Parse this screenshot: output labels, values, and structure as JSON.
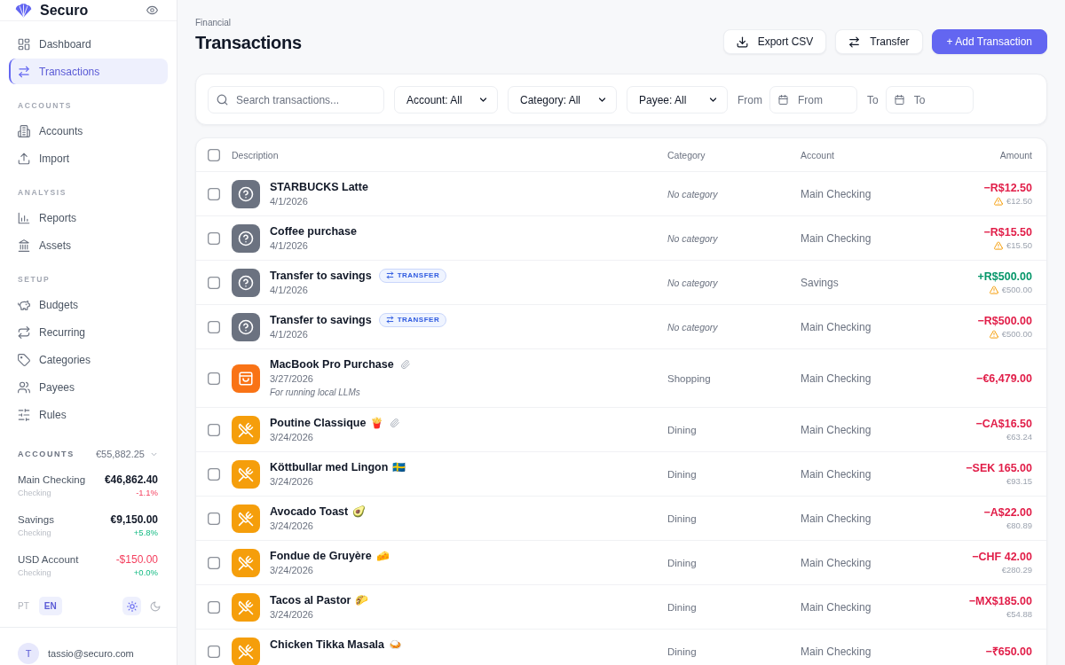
{
  "sidebar": {
    "brand": "Securo",
    "nav": [
      {
        "items": [
          {
            "label": "Dashboard",
            "selected": false
          },
          {
            "label": "Transactions",
            "selected": true
          }
        ]
      },
      {
        "heading": "ACCOUNTS",
        "items": [
          {
            "label": "Accounts",
            "selected": false
          },
          {
            "label": "Import",
            "selected": false
          }
        ]
      },
      {
        "heading": "ANALYSIS",
        "items": [
          {
            "label": "Reports",
            "selected": false
          },
          {
            "label": "Assets",
            "selected": false
          }
        ]
      },
      {
        "heading": "SETUP",
        "items": [
          {
            "label": "Budgets",
            "selected": false
          },
          {
            "label": "Recurring",
            "selected": false
          },
          {
            "label": "Categories",
            "selected": false
          },
          {
            "label": "Payees",
            "selected": false
          },
          {
            "label": "Rules",
            "selected": false
          }
        ]
      }
    ],
    "accounts_summary": {
      "heading": "ACCOUNTS",
      "total": "€55,882.25",
      "accounts": [
        {
          "name": "Main Checking",
          "type": "Checking",
          "balance": "€46,862.40",
          "balance_negative": false,
          "change": "-1.1%",
          "change_negative": true
        },
        {
          "name": "Savings",
          "type": "Checking",
          "balance": "€9,150.00",
          "balance_negative": false,
          "change": "+5.8%",
          "change_negative": false
        },
        {
          "name": "USD Account",
          "type": "Checking",
          "balance": "-$150.00",
          "balance_negative": true,
          "change": "+0.0%",
          "change_negative": false
        }
      ]
    },
    "languages": [
      {
        "label": "PT",
        "selected": false
      },
      {
        "label": "EN",
        "selected": true
      }
    ],
    "theme_toggle": [
      {
        "selected": true
      },
      {
        "selected": false
      }
    ],
    "user": {
      "initial": "T",
      "email": "tassio@securo.com"
    }
  },
  "header": {
    "breadcrumb": "Financial",
    "title": "Transactions",
    "actions": [
      {
        "label": "Export CSV",
        "kind": "secondary"
      },
      {
        "label": "Transfer",
        "kind": "secondary"
      },
      {
        "label": "+ Add Transaction",
        "kind": "primary"
      }
    ]
  },
  "filters": {
    "search": {
      "placeholder": "Search transactions..."
    },
    "selects": [
      {
        "value": "Account: All"
      },
      {
        "value": "Category: All"
      },
      {
        "value": "Payee: All"
      }
    ],
    "date_from": {
      "label": "From",
      "placeholder": "From"
    },
    "date_to": {
      "label": "To",
      "placeholder": "To"
    }
  },
  "table": {
    "select_all": {
      "checked": false
    },
    "columns": [
      "Description",
      "Category",
      "Account",
      "Amount"
    ],
    "rows": [
      {
        "checked": false,
        "kind": "uncategorized",
        "name": "STARBUCKS Latte",
        "date": "4/1/2026",
        "attachment": false,
        "category": "No category",
        "account": "Main Checking",
        "amount": "−R$12.50",
        "income": false,
        "converted": "€12.50",
        "warning": true
      },
      {
        "checked": false,
        "kind": "uncategorized",
        "name": "Coffee purchase",
        "date": "4/1/2026",
        "attachment": false,
        "category": "No category",
        "account": "Main Checking",
        "amount": "−R$15.50",
        "income": false,
        "converted": "€15.50",
        "warning": true
      },
      {
        "checked": false,
        "kind": "uncategorized",
        "name": "Transfer to savings",
        "badge": "TRANSFER",
        "date": "4/1/2026",
        "attachment": false,
        "category": "No category",
        "account": "Savings",
        "amount": "+R$500.00",
        "income": true,
        "converted": "€500.00",
        "warning": true
      },
      {
        "checked": false,
        "kind": "uncategorized",
        "name": "Transfer to savings",
        "badge": "TRANSFER",
        "date": "4/1/2026",
        "attachment": false,
        "category": "No category",
        "account": "Main Checking",
        "amount": "−R$500.00",
        "income": false,
        "converted": "€500.00",
        "warning": true
      },
      {
        "checked": false,
        "kind": "shopping",
        "name": "MacBook Pro Purchase",
        "date": "3/27/2026",
        "note": "For running local LLMs",
        "attachment": true,
        "category": "Shopping",
        "account": "Main Checking",
        "amount": "−€6,479.00",
        "income": false
      },
      {
        "checked": false,
        "kind": "dining",
        "name": "Poutine Classique",
        "emoji": "🍟",
        "date": "3/24/2026",
        "attachment": true,
        "category": "Dining",
        "account": "Main Checking",
        "amount": "−CA$16.50",
        "income": false,
        "converted": "€63.24",
        "warning": false
      },
      {
        "checked": false,
        "kind": "dining",
        "name": "Köttbullar med Lingon",
        "emoji": "🇸🇪",
        "date": "3/24/2026",
        "attachment": false,
        "category": "Dining",
        "account": "Main Checking",
        "amount": "−SEK 165.00",
        "income": false,
        "converted": "€93.15",
        "warning": false
      },
      {
        "checked": false,
        "kind": "dining",
        "name": "Avocado Toast",
        "emoji": "🥑",
        "date": "3/24/2026",
        "attachment": false,
        "category": "Dining",
        "account": "Main Checking",
        "amount": "−A$22.00",
        "income": false,
        "converted": "€80.89",
        "warning": false
      },
      {
        "checked": false,
        "kind": "dining",
        "name": "Fondue de Gruyère",
        "emoji": "🧀",
        "date": "3/24/2026",
        "attachment": false,
        "category": "Dining",
        "account": "Main Checking",
        "amount": "−CHF 42.00",
        "income": false,
        "converted": "€280.29",
        "warning": false
      },
      {
        "checked": false,
        "kind": "dining",
        "name": "Tacos al Pastor",
        "emoji": "🌮",
        "date": "3/24/2026",
        "attachment": false,
        "category": "Dining",
        "account": "Main Checking",
        "amount": "−MX$185.00",
        "income": false,
        "converted": "€54.88",
        "warning": false
      },
      {
        "checked": false,
        "kind": "dining",
        "name": "Chicken Tikka Masala",
        "emoji": "🍛",
        "attachment": false,
        "category": "Dining",
        "account": "Main Checking",
        "amount": "−₹650.00",
        "income": false
      }
    ]
  }
}
